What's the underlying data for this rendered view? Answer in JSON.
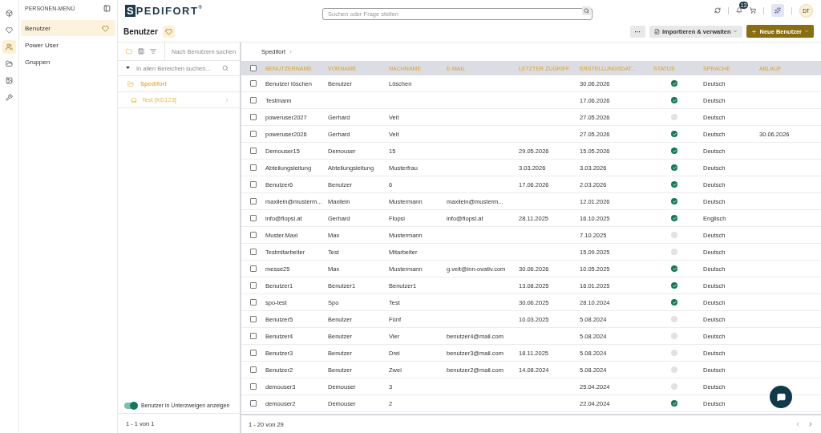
{
  "rail": [
    {
      "kind": "cube",
      "selected": false
    },
    {
      "kind": "heart",
      "selected": false
    },
    {
      "kind": "users",
      "selected": true
    },
    {
      "kind": "folders",
      "selected": false
    },
    {
      "kind": "chart",
      "selected": false
    },
    {
      "kind": "tools",
      "selected": false
    }
  ],
  "menu": {
    "title": "PERSONEN-MENÜ",
    "items": [
      {
        "label": "Benutzer",
        "selected": true
      },
      {
        "label": "Power User",
        "selected": false
      },
      {
        "label": "Gruppen",
        "selected": false
      }
    ]
  },
  "topbar": {
    "logo": "SPEDIFORT",
    "logo_mark": "®",
    "search": {
      "placeholder": "Suchen oder Frage stellen"
    },
    "notifications": "13",
    "avatar": "DT"
  },
  "page": {
    "title": "Benutzer",
    "actions": {
      "more": "···",
      "import": "Importieren & verwalten",
      "new": "Neue Benutzer"
    }
  },
  "tree": {
    "user_search": {
      "placeholder": "Nach Benutzern suchen"
    },
    "area_search": {
      "placeholder": "In allen Bereichen suchen..."
    },
    "root": "Spedifort",
    "children": [
      {
        "label": "Test [KD123]"
      }
    ],
    "subtree_toggle": {
      "label": "Benutzer in Unterzweigen anzeigen",
      "on": true
    },
    "footer": "1 - 1 von 1"
  },
  "breadcrumb": [
    "Spedifort"
  ],
  "table": {
    "all_checked": false,
    "columns": [
      "BENUTZERNAME",
      "VORNAME",
      "NACHNAME",
      "E-MAIL",
      "LETZTER ZUGRIFF",
      "ERSTELLUNGSDAT...",
      "STATUS",
      "SPRACHE",
      "ABLAUF"
    ],
    "rows": [
      {
        "checked": false,
        "username": "Benutzer löschen",
        "first": "Benutzer",
        "last": "Löschen",
        "email": "",
        "last_access": "",
        "created": "30.06.2026",
        "active": true,
        "language": "Deutsch",
        "expiry": ""
      },
      {
        "checked": false,
        "username": "Testmann",
        "first": "",
        "last": "",
        "email": "",
        "last_access": "",
        "created": "17.06.2026",
        "active": true,
        "language": "Deutsch",
        "expiry": ""
      },
      {
        "checked": false,
        "username": "poweruser2027",
        "first": "Gerhard",
        "last": "Veit",
        "email": "",
        "last_access": "",
        "created": "27.05.2026",
        "active": false,
        "language": "Deutsch",
        "expiry": ""
      },
      {
        "checked": false,
        "username": "poweruser2026",
        "first": "Gerhard",
        "last": "Veit",
        "email": "",
        "last_access": "",
        "created": "27.05.2026",
        "active": true,
        "language": "Deutsch",
        "expiry": "30.06.2026"
      },
      {
        "checked": false,
        "username": "Demouser15",
        "first": "Demouser",
        "last": "15",
        "email": "",
        "last_access": "29.05.2026",
        "created": "15.05.2026",
        "active": true,
        "language": "Deutsch",
        "expiry": ""
      },
      {
        "checked": false,
        "username": "Abteilungsleitung",
        "first": "Abteilungsleitung",
        "last": "Musterfrau",
        "email": "",
        "last_access": "3.03.2026",
        "created": "3.03.2026",
        "active": true,
        "language": "Deutsch",
        "expiry": ""
      },
      {
        "checked": false,
        "username": "Benutzer6",
        "first": "Benutzer",
        "last": "6",
        "email": "",
        "last_access": "17.06.2026",
        "created": "2.03.2026",
        "active": true,
        "language": "Deutsch",
        "expiry": ""
      },
      {
        "checked": false,
        "username": "maxilein@musterm...",
        "first": "Maxilein",
        "last": "Mustermann",
        "email": "maxilein@musterm...",
        "last_access": "",
        "created": "12.01.2026",
        "active": true,
        "language": "Deutsch",
        "expiry": ""
      },
      {
        "checked": false,
        "username": "info@flopsi.at",
        "first": "Gerhard",
        "last": "Flopsi",
        "email": "info@flopsi.at",
        "last_access": "28.11.2025",
        "created": "16.10.2025",
        "active": true,
        "language": "Englisch",
        "expiry": ""
      },
      {
        "checked": false,
        "username": "Muster.Maxi",
        "first": "Max",
        "last": "Mustermann",
        "email": "",
        "last_access": "",
        "created": "7.10.2025",
        "active": false,
        "language": "Deutsch",
        "expiry": ""
      },
      {
        "checked": false,
        "username": "Testmitarbeiter",
        "first": "Test",
        "last": "Mitarbeiter",
        "email": "",
        "last_access": "",
        "created": "15.09.2025",
        "active": false,
        "language": "Deutsch",
        "expiry": ""
      },
      {
        "checked": false,
        "username": "messe25",
        "first": "Max",
        "last": "Mustermann",
        "email": "g.veit@inn-ovativ.com",
        "last_access": "30.06.2026",
        "created": "10.05.2025",
        "active": true,
        "language": "Deutsch",
        "expiry": ""
      },
      {
        "checked": false,
        "username": "Benutzer1",
        "first": "Benutzer1",
        "last": "Benutzer1",
        "email": "",
        "last_access": "13.08.2025",
        "created": "16.01.2025",
        "active": true,
        "language": "Deutsch",
        "expiry": ""
      },
      {
        "checked": false,
        "username": "spo-test",
        "first": "Spo",
        "last": "Test",
        "email": "",
        "last_access": "30.06.2025",
        "created": "28.10.2024",
        "active": true,
        "language": "Deutsch",
        "expiry": ""
      },
      {
        "checked": false,
        "username": "Benutzer5",
        "first": "Benutzer",
        "last": "Fünf",
        "email": "",
        "last_access": "10.03.2025",
        "created": "5.08.2024",
        "active": false,
        "language": "Deutsch",
        "expiry": ""
      },
      {
        "checked": false,
        "username": "Benutzer4",
        "first": "Benutzer",
        "last": "Vier",
        "email": "benutzer4@mail.com",
        "last_access": "",
        "created": "5.08.2024",
        "active": false,
        "language": "Deutsch",
        "expiry": ""
      },
      {
        "checked": false,
        "username": "Benutzer3",
        "first": "Benutzer",
        "last": "Drei",
        "email": "benutzer3@mail.com",
        "last_access": "18.11.2025",
        "created": "5.08.2024",
        "active": false,
        "language": "Deutsch",
        "expiry": ""
      },
      {
        "checked": false,
        "username": "Benutzer2",
        "first": "Benutzer",
        "last": "Zwei",
        "email": "benutzer2@mail.com",
        "last_access": "14.08.2024",
        "created": "5.08.2024",
        "active": false,
        "language": "Deutsch",
        "expiry": ""
      },
      {
        "checked": false,
        "username": "demouser3",
        "first": "Demouser",
        "last": "3",
        "email": "",
        "last_access": "",
        "created": "25.04.2024",
        "active": false,
        "language": "Deutsch",
        "expiry": ""
      },
      {
        "checked": false,
        "username": "demouser2",
        "first": "Demouser",
        "last": "2",
        "email": "",
        "last_access": "",
        "created": "22.04.2024",
        "active": true,
        "language": "Deutsch",
        "expiry": ""
      }
    ],
    "footer": "1 - 20 von 29"
  }
}
